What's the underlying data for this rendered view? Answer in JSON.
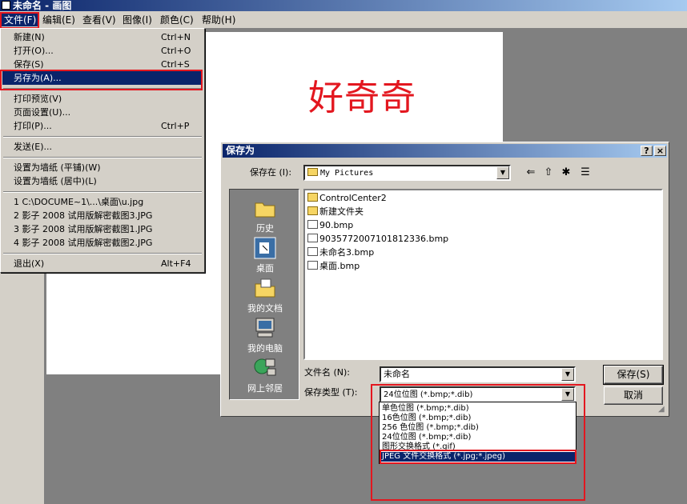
{
  "window": {
    "title": "未命名 - 画图"
  },
  "menubar": [
    {
      "label": "文件(F)"
    },
    {
      "label": "编辑(E)"
    },
    {
      "label": "查看(V)"
    },
    {
      "label": "图像(I)"
    },
    {
      "label": "颜色(C)"
    },
    {
      "label": "帮助(H)"
    }
  ],
  "canvas": {
    "text": "好奇奇"
  },
  "file_menu": {
    "new": {
      "label": "新建(N)",
      "shortcut": "Ctrl+N"
    },
    "open": {
      "label": "打开(O)...",
      "shortcut": "Ctrl+O"
    },
    "save": {
      "label": "保存(S)",
      "shortcut": "Ctrl+S"
    },
    "save_as": {
      "label": "另存为(A)..."
    },
    "print_preview": {
      "label": "打印预览(V)"
    },
    "page_setup": {
      "label": "页面设置(U)..."
    },
    "print": {
      "label": "打印(P)...",
      "shortcut": "Ctrl+P"
    },
    "send": {
      "label": "发送(E)..."
    },
    "wallpaper_tile": {
      "label": "设置为墙纸 (平铺)(W)"
    },
    "wallpaper_center": {
      "label": "设置为墙纸 (居中)(L)"
    },
    "recent": [
      "1 C:\\DOCUME~1\\...\\桌面\\u.jpg",
      "2 影子 2008 试用版解密截图3.JPG",
      "3 影子 2008 试用版解密截图1.JPG",
      "4 影子 2008 试用版解密截图2.JPG"
    ],
    "exit": {
      "label": "退出(X)",
      "shortcut": "Alt+F4"
    }
  },
  "dialog": {
    "title": "保存为",
    "help_btn": "?",
    "close_btn": "×",
    "save_in_label": "保存在 (I):",
    "save_in_value": "My Pictures",
    "places": [
      {
        "label": "历史",
        "icon": "history-folder-icon"
      },
      {
        "label": "桌面",
        "icon": "desktop-icon"
      },
      {
        "label": "我的文档",
        "icon": "my-documents-icon"
      },
      {
        "label": "我的电脑",
        "icon": "my-computer-icon"
      },
      {
        "label": "网上邻居",
        "icon": "network-places-icon"
      }
    ],
    "files": [
      {
        "name": "ControlCenter2",
        "type": "folder"
      },
      {
        "name": "新建文件夹",
        "type": "folder"
      },
      {
        "name": "90.bmp",
        "type": "bmp"
      },
      {
        "name": "9035772007101812336.bmp",
        "type": "bmp"
      },
      {
        "name": "未命名3.bmp",
        "type": "bmp"
      },
      {
        "name": "桌面.bmp",
        "type": "bmp"
      }
    ],
    "filename_label": "文件名 (N):",
    "filename_value": "未命名",
    "filetype_label": "保存类型 (T):",
    "filetype_value": "24位位图 (*.bmp;*.dib)",
    "save_btn": "保存(S)",
    "cancel_btn": "取消",
    "filetype_options": [
      "单色位图 (*.bmp;*.dib)",
      "16色位图 (*.bmp;*.dib)",
      "256 色位图 (*.bmp;*.dib)",
      "24位位图 (*.bmp;*.dib)",
      "图形交换格式 (*.gif)",
      "JPEG 文件交换格式 (*.jpg;*.jpeg)"
    ]
  },
  "colors": {
    "accent": "#0a246a",
    "highlight_box": "#e3171f",
    "canvas_text": "#e3171f",
    "face": "#d4d0c8"
  }
}
